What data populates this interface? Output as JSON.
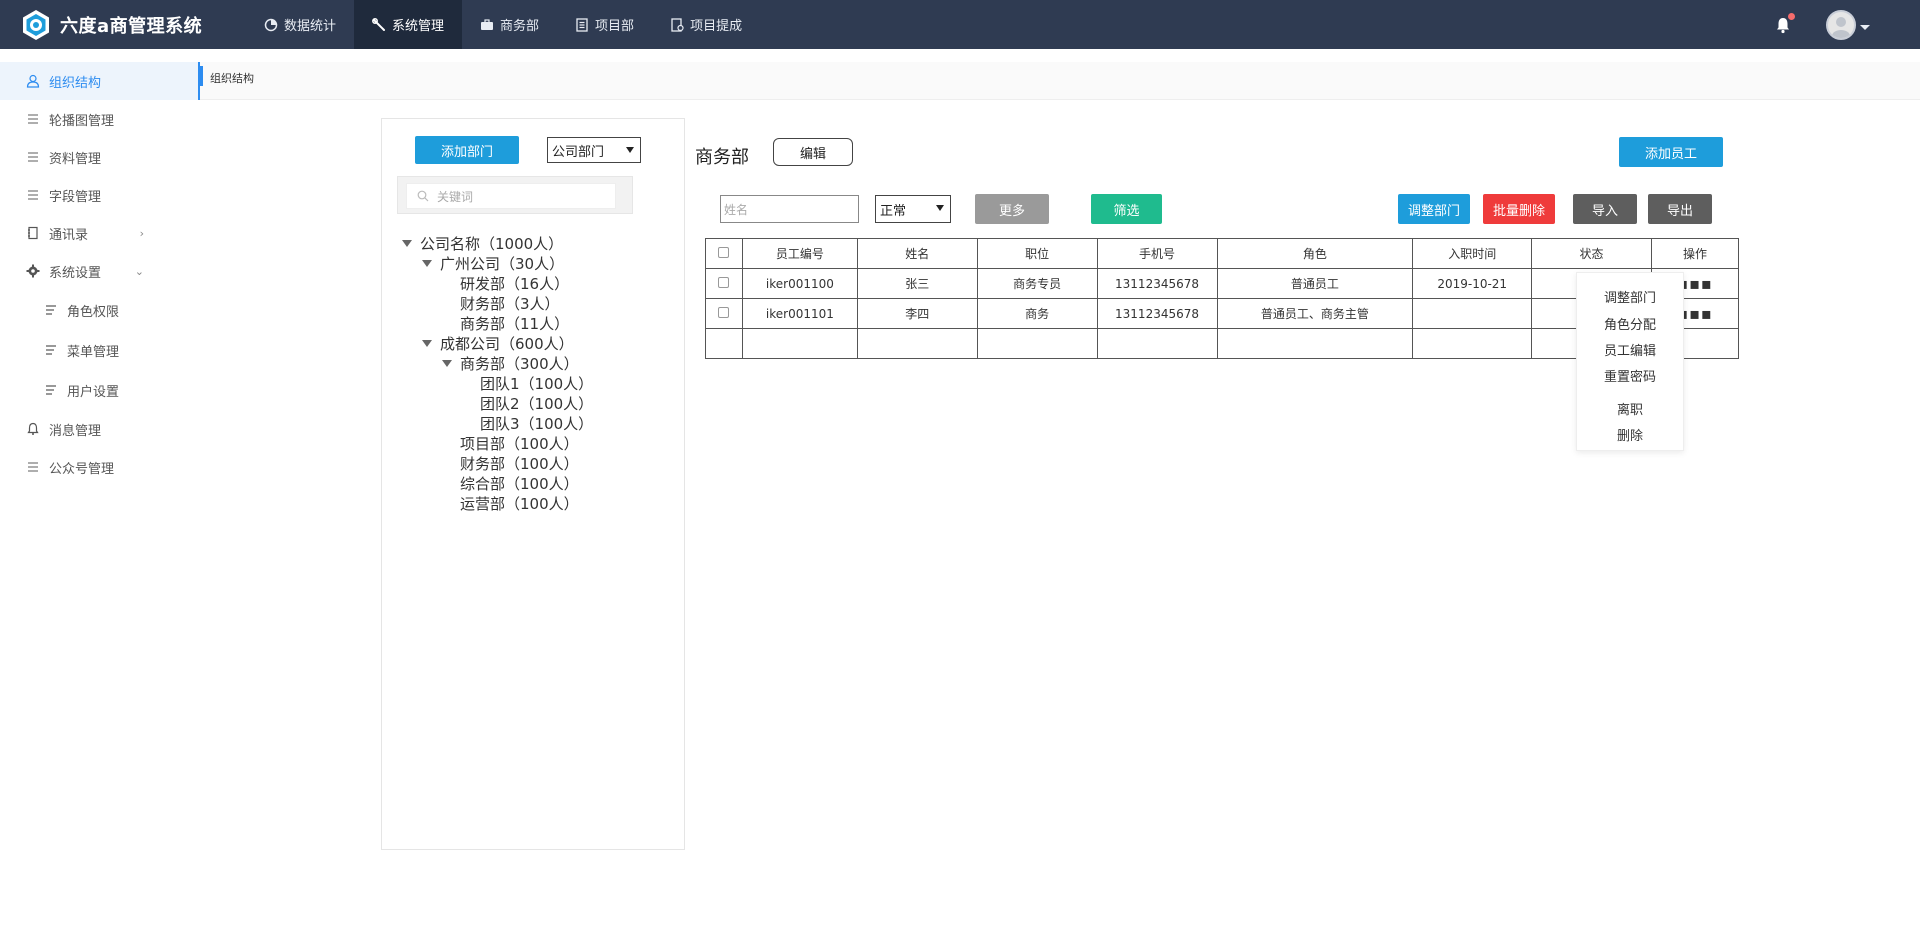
{
  "app": {
    "title": "六度a商管理系统"
  },
  "topnav": [
    {
      "label": "数据统计",
      "icon": "pie-chart-icon"
    },
    {
      "label": "系统管理",
      "icon": "wrench-icon",
      "active": true
    },
    {
      "label": "商务部",
      "icon": "briefcase-icon"
    },
    {
      "label": "项目部",
      "icon": "document-icon"
    },
    {
      "label": "项目提成",
      "icon": "report-icon"
    }
  ],
  "sidebar": {
    "items": [
      {
        "label": "组织结构",
        "icon": "user-icon",
        "active": true
      },
      {
        "label": "轮播图管理",
        "icon": "list-icon"
      },
      {
        "label": "资料管理",
        "icon": "list-icon"
      },
      {
        "label": "字段管理",
        "icon": "list-icon"
      },
      {
        "label": "通讯录",
        "icon": "book-icon",
        "arrow": "›"
      },
      {
        "label": "系统设置",
        "icon": "gear-icon",
        "arrow": "⌄"
      },
      {
        "label": "角色权限",
        "icon": "menu-icon",
        "sub": true
      },
      {
        "label": "菜单管理",
        "icon": "menu-icon",
        "sub": true
      },
      {
        "label": "用户设置",
        "icon": "menu-icon",
        "sub": true
      },
      {
        "label": "消息管理",
        "icon": "bell-icon"
      },
      {
        "label": "公众号管理",
        "icon": "list-icon"
      }
    ]
  },
  "breadcrumb": {
    "current": "组织结构"
  },
  "tree_panel": {
    "add_dept_label": "添加部门",
    "select_value": "公司部门",
    "search_placeholder": "关键词",
    "nodes": [
      {
        "label": "公司名称（1000人）",
        "level": 0,
        "expanded": true
      },
      {
        "label": "广州公司（30人）",
        "level": 1,
        "expanded": true
      },
      {
        "label": "研发部（16人）",
        "level": 2
      },
      {
        "label": "财务部（3人）",
        "level": 2
      },
      {
        "label": "商务部（11人）",
        "level": 2
      },
      {
        "label": "成都公司（600人）",
        "level": 1,
        "expanded": true
      },
      {
        "label": "商务部（300人）",
        "level": 2,
        "expanded": true
      },
      {
        "label": "团队1（100人）",
        "level": 3
      },
      {
        "label": "团队2（100人）",
        "level": 3
      },
      {
        "label": "团队3（100人）",
        "level": 3
      },
      {
        "label": "项目部（100人）",
        "level": 2
      },
      {
        "label": "财务部（100人）",
        "level": 2
      },
      {
        "label": "综合部（100人）",
        "level": 2
      },
      {
        "label": "运营部（100人）",
        "level": 2
      }
    ]
  },
  "main": {
    "dept_title": "商务部",
    "edit_label": "编辑",
    "add_staff_label": "添加员工",
    "name_placeholder": "姓名",
    "status_select": "正常",
    "more_label": "更多",
    "filter_label": "筛选",
    "adjust_dept_label": "调整部门",
    "batch_delete_label": "批量删除",
    "import_label": "导入",
    "export_label": "导出",
    "table": {
      "headers": [
        "员工编号",
        "姓名",
        "职位",
        "手机号",
        "角色",
        "入职时间",
        "状态",
        "操作"
      ],
      "rows": [
        {
          "id": "iker001100",
          "name": "张三",
          "position": "商务专员",
          "phone": "13112345678",
          "role": "普通员工",
          "date": "2019-10-21",
          "status": "",
          "ops": "▪▪▪"
        },
        {
          "id": "iker001101",
          "name": "李四",
          "position": "商务",
          "phone": "13112345678",
          "role": "普通员工、商务主管",
          "date": "",
          "status": "",
          "ops": "▪▪▪"
        }
      ]
    },
    "dropdown": [
      "调整部门",
      "角色分配",
      "员工编辑",
      "重置密码",
      "离职",
      "删除"
    ]
  },
  "colors": {
    "topbar": "#2f3b52",
    "accent": "#2d8cf0",
    "primary_btn": "#1e9ddb",
    "green_btn": "#1fbb8e",
    "red_btn": "#ef3b3b"
  }
}
